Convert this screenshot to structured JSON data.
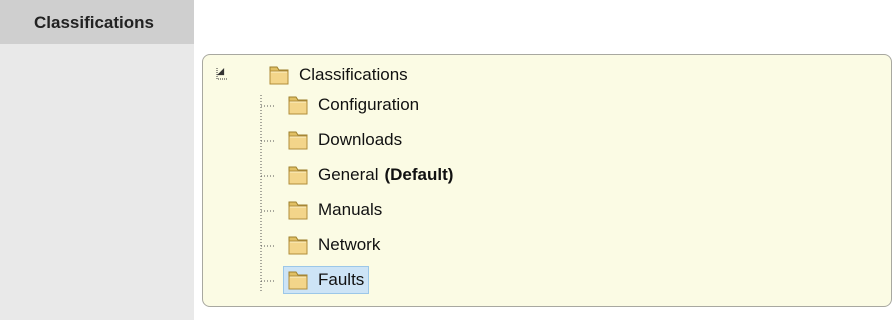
{
  "form": {
    "field_label": "Classifications"
  },
  "tree": {
    "root": {
      "label": "Classifications",
      "icon": "folder-icon",
      "expanded": true
    },
    "children": [
      {
        "label": "Configuration",
        "suffix": "",
        "selected": false,
        "icon": "folder-icon"
      },
      {
        "label": "Downloads",
        "suffix": "",
        "selected": false,
        "icon": "folder-icon"
      },
      {
        "label": "General",
        "suffix": "(Default)",
        "selected": false,
        "icon": "folder-icon"
      },
      {
        "label": "Manuals",
        "suffix": "",
        "selected": false,
        "icon": "folder-icon"
      },
      {
        "label": "Network",
        "suffix": "",
        "selected": false,
        "icon": "folder-icon"
      },
      {
        "label": "Faults",
        "suffix": "",
        "selected": true,
        "icon": "folder-icon"
      }
    ]
  },
  "colors": {
    "panel_background": "#fbfbe4",
    "selection_background": "#cde4f6",
    "label_column_background": "#e9e9e9",
    "label_header_background": "#cfcfcf"
  }
}
